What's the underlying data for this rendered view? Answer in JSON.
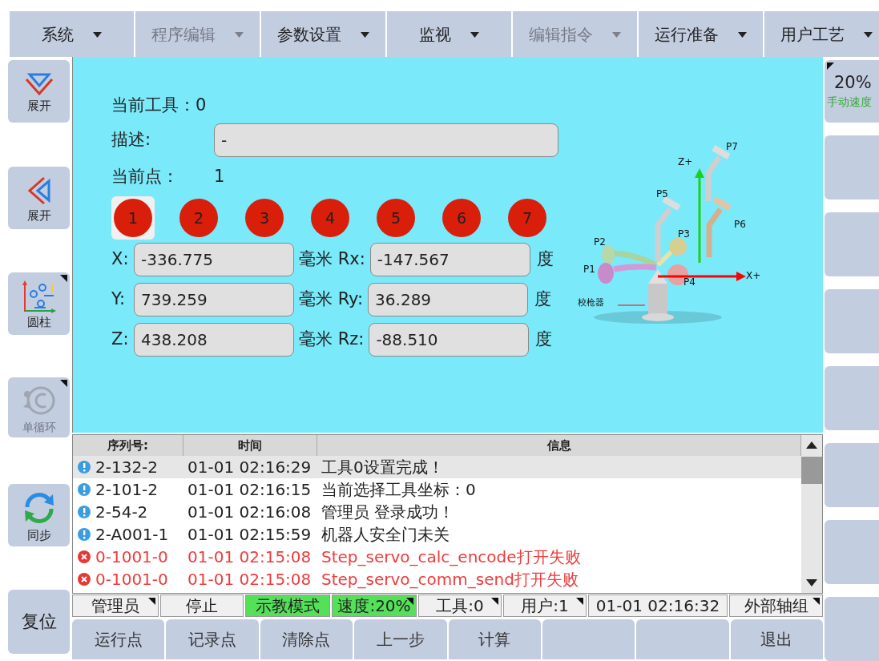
{
  "menu": [
    {
      "label": "系统",
      "disabled": false
    },
    {
      "label": "程序编辑",
      "disabled": true
    },
    {
      "label": "参数设置",
      "disabled": false
    },
    {
      "label": "监视",
      "disabled": false
    },
    {
      "label": "编辑指令",
      "disabled": true
    },
    {
      "label": "运行准备",
      "disabled": false
    },
    {
      "label": "用户工艺",
      "disabled": false
    }
  ],
  "left_buttons": [
    {
      "kind": "expand-down",
      "label": "展开",
      "disabled": false,
      "has_menu": false
    },
    {
      "kind": "expand-left",
      "label": "展开",
      "disabled": false,
      "has_menu": false
    },
    {
      "kind": "cylinder",
      "label": "圆柱",
      "disabled": false,
      "has_menu": true
    },
    {
      "kind": "cycle",
      "label": "单循环",
      "disabled": true,
      "has_menu": true
    },
    {
      "kind": "sync",
      "label": "同步",
      "disabled": false,
      "has_menu": false
    },
    {
      "kind": "reset",
      "label": "复位",
      "disabled": false,
      "has_menu": false
    }
  ],
  "speed_button": {
    "value": "20%",
    "label": "手动速度"
  },
  "tool": {
    "label": "当前工具：",
    "value": "0"
  },
  "description": {
    "label": "描述:",
    "value": "-"
  },
  "current_point": {
    "label": "当前点：",
    "value": "1"
  },
  "points": [
    {
      "label": "1",
      "selected": true
    },
    {
      "label": "2",
      "selected": false
    },
    {
      "label": "3",
      "selected": false
    },
    {
      "label": "4",
      "selected": false
    },
    {
      "label": "5",
      "selected": false
    },
    {
      "label": "6",
      "selected": false
    },
    {
      "label": "7",
      "selected": false
    }
  ],
  "coordinates": [
    {
      "axis": "X:",
      "value": "-336.775",
      "unit": "毫米 Rx:",
      "rot_value": "-147.567",
      "rot_unit": "度"
    },
    {
      "axis": "Y:",
      "value": "739.259",
      "unit": "毫米 Ry:",
      "rot_value": "36.289",
      "rot_unit": "度"
    },
    {
      "axis": "Z:",
      "value": "438.208",
      "unit": "毫米 Rz:",
      "rot_value": "-88.510",
      "rot_unit": "度"
    }
  ],
  "diagram": {
    "labels": [
      "P7",
      "Z+",
      "P5",
      "P6",
      "P2",
      "P3",
      "P1",
      "X+",
      "P4",
      "校枪器"
    ]
  },
  "log": {
    "columns": [
      "序列号:",
      "时间",
      "信息"
    ],
    "rows": [
      {
        "kind": "info",
        "selected": true,
        "id": "2-132-2",
        "time": "01-01 02:16:29",
        "message": "工具0设置完成！"
      },
      {
        "kind": "info",
        "selected": false,
        "id": "2-101-2",
        "time": "01-01 02:16:15",
        "message": "当前选择工具坐标：0"
      },
      {
        "kind": "info",
        "selected": false,
        "id": "2-54-2",
        "time": "01-01 02:16:08",
        "message": "管理员 登录成功！"
      },
      {
        "kind": "info",
        "selected": false,
        "id": "2-A001-1",
        "time": "01-01 02:15:59",
        "message": "机器人安全门未关"
      },
      {
        "kind": "error",
        "selected": false,
        "id": "0-1001-0",
        "time": "01-01 02:15:08",
        "message": "Step_servo_calc_encode打开失败"
      },
      {
        "kind": "error",
        "selected": false,
        "id": "0-1001-0",
        "time": "01-01 02:15:08",
        "message": "Step_servo_comm_send打开失败"
      }
    ]
  },
  "status_bar": [
    {
      "text": "管理员",
      "highlighted": false,
      "has_menu": true
    },
    {
      "text": "停止",
      "highlighted": false,
      "has_menu": false
    },
    {
      "text": "示教模式",
      "highlighted": true,
      "has_menu": false
    },
    {
      "text": "速度:20%",
      "highlighted": true,
      "has_menu": true
    },
    {
      "text": "工具:0",
      "highlighted": false,
      "has_menu": true
    },
    {
      "text": "用户:1",
      "highlighted": false,
      "has_menu": true
    },
    {
      "text": "01-01 02:16:32",
      "highlighted": false,
      "has_menu": false
    },
    {
      "text": "外部轴组",
      "highlighted": false,
      "has_menu": true
    }
  ],
  "bottom_buttons": [
    {
      "kind": "text",
      "label": "运行点"
    },
    {
      "kind": "text",
      "label": "记录点"
    },
    {
      "kind": "text",
      "label": "清除点"
    },
    {
      "kind": "text",
      "label": "上一步"
    },
    {
      "kind": "text",
      "label": "计算"
    },
    {
      "kind": "blank"
    },
    {
      "kind": "blank"
    },
    {
      "kind": "text",
      "label": "退出"
    }
  ]
}
